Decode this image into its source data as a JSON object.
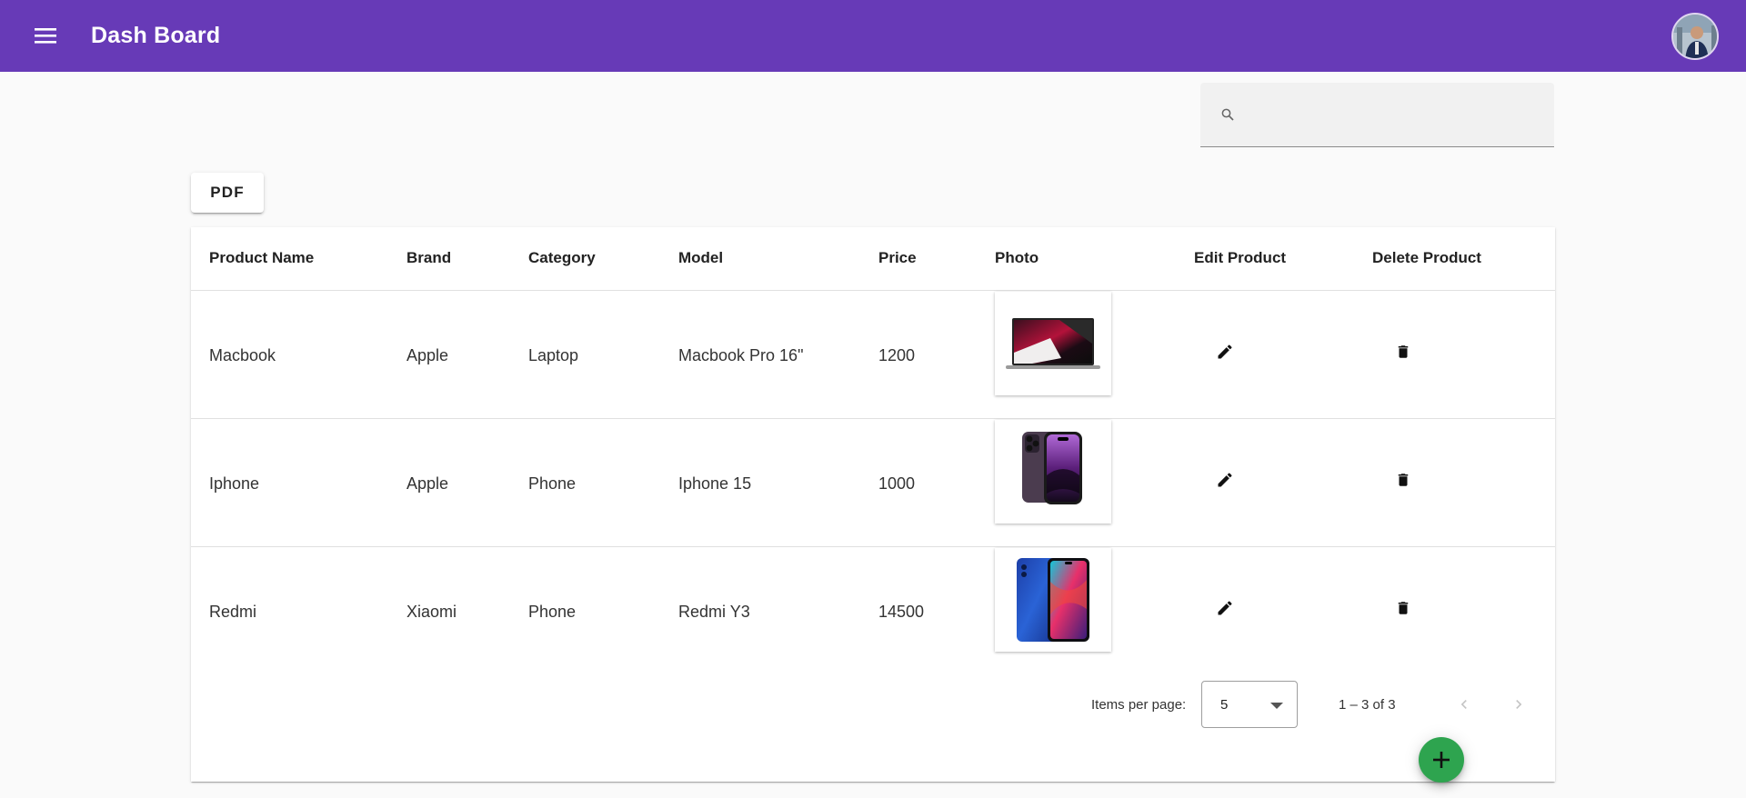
{
  "app": {
    "title": "Dash Board",
    "brand_color": "#673ab7"
  },
  "toolbar": {
    "menu_icon": "menu-icon",
    "avatar_icon": "user-avatar"
  },
  "search": {
    "icon": "search-icon",
    "value": "",
    "placeholder": ""
  },
  "actions": {
    "pdf_label": "PDF",
    "add_icon": "plus-icon",
    "add_color": "#2ea44f"
  },
  "table": {
    "headers": [
      "Product Name",
      "Brand",
      "Category",
      "Model",
      "Price",
      "Photo",
      "Edit Product",
      "Delete Product"
    ],
    "rows": [
      {
        "name": "Macbook",
        "brand": "Apple",
        "category": "Laptop",
        "model": "Macbook Pro 16\"",
        "price": "1200",
        "photo": "laptop-image"
      },
      {
        "name": "Iphone",
        "brand": "Apple",
        "category": "Phone",
        "model": "Iphone 15",
        "price": "1000",
        "photo": "iphone-image"
      },
      {
        "name": "Redmi",
        "brand": "Xiaomi",
        "category": "Phone",
        "model": "Redmi Y3",
        "price": "14500",
        "photo": "redmi-phone-image"
      }
    ],
    "edit_icon": "pencil-icon",
    "delete_icon": "trash-icon"
  },
  "paginator": {
    "items_per_page_label": "Items per page:",
    "page_size": "5",
    "range_label": "1 – 3 of 3",
    "prev_icon": "chevron-left-icon",
    "next_icon": "chevron-right-icon"
  }
}
